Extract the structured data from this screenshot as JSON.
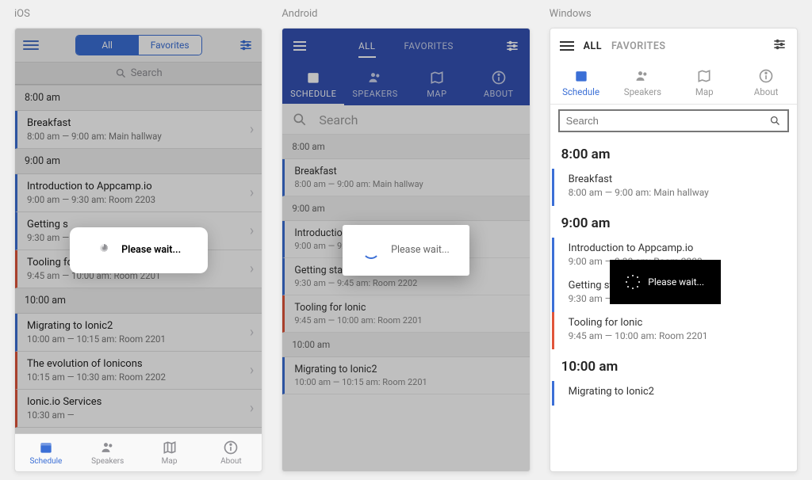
{
  "platforms": {
    "ios": "iOS",
    "android": "Android",
    "windows": "Windows"
  },
  "segment": {
    "all": "All",
    "all_upper": "ALL",
    "favorites": "Favorites",
    "favorites_upper": "FAVORITES"
  },
  "search": {
    "label": "Search"
  },
  "tabs": {
    "schedule": "Schedule",
    "schedule_upper": "SCHEDULE",
    "speakers": "Speakers",
    "speakers_upper": "SPEAKERS",
    "map": "Map",
    "map_upper": "MAP",
    "about": "About",
    "about_upper": "ABOUT"
  },
  "loading": {
    "text_bold": "Please wait...",
    "text": "Please wait..."
  },
  "colors": {
    "primary": "#3b6fd6",
    "android_header": "#3452b5",
    "accent_blue": "#3b6fd6",
    "accent_orange": "#e0553a"
  },
  "groups": [
    {
      "time": "8:00 am",
      "items": [
        {
          "title": "Breakfast",
          "sub": "8:00 am — 9:00 am: Main hallway",
          "accent": "#3b6fd6"
        }
      ]
    },
    {
      "time": "9:00 am",
      "items": [
        {
          "title": "Introduction to Appcamp.io",
          "sub": "9:00 am — 9:30 am: Room 2203",
          "accent": "#3b6fd6"
        },
        {
          "title": "Getting started with Ionic",
          "sub": "9:30 am — 9:45 am: Room 2202",
          "accent": "#3b6fd6"
        },
        {
          "title": "Tooling for Ionic",
          "sub": "9:45 am — 10:00 am: Room 2201",
          "accent": "#e0553a"
        }
      ]
    },
    {
      "time": "10:00 am",
      "items": [
        {
          "title": "Migrating to Ionic2",
          "sub": "10:00 am — 10:15 am: Room 2201",
          "accent": "#3b6fd6"
        },
        {
          "title": "The evolution of Ionicons",
          "sub": "10:15 am — 10:30 am: Room 2202",
          "accent": "#e0553a"
        },
        {
          "title": "Ionic.io Services",
          "sub": "10:30 am — ",
          "accent": "#e0553a"
        }
      ]
    }
  ],
  "ios_partial": {
    "getting_trunc": "Getting s",
    "tooling_trunc": "Tooling for"
  }
}
